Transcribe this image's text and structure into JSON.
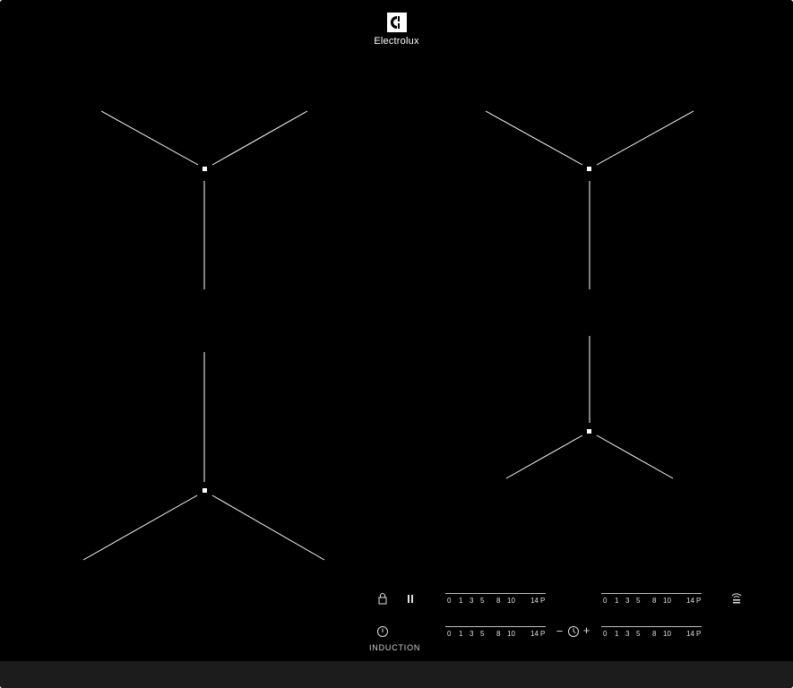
{
  "brand": {
    "name": "Electrolux",
    "logo_icon": "electrolux-logo-icon"
  },
  "panel_label": "INDUCTION",
  "colors": {
    "surface": "#000000",
    "markings": "#ffffff",
    "edge": "#1c1c1c"
  },
  "controls": {
    "lock_icon": "lock-icon",
    "pause_icon": "pause-icon",
    "power_icon": "power-icon",
    "timer": {
      "minus": "−",
      "plus": "+",
      "icon": "timer-icon"
    },
    "hob2hood_icon": "wifi-hood-icon"
  },
  "power_scale": {
    "labels": [
      "0",
      "1",
      "3",
      "5",
      "8",
      "10",
      "14",
      "P"
    ]
  },
  "zones": [
    "cooking-zone-rear-left",
    "cooking-zone-front-left",
    "cooking-zone-rear-right",
    "cooking-zone-front-right"
  ]
}
